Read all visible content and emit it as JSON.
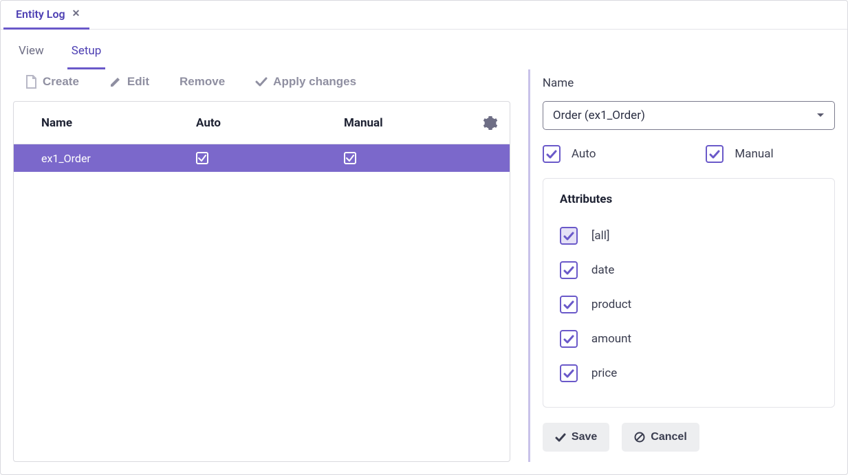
{
  "top_tab": {
    "title": "Entity Log"
  },
  "nav_tabs": {
    "view": "View",
    "setup": "Setup"
  },
  "toolbar": {
    "create": "Create",
    "edit": "Edit",
    "remove": "Remove",
    "apply": "Apply changes"
  },
  "table": {
    "headers": {
      "name": "Name",
      "auto": "Auto",
      "manual": "Manual"
    },
    "rows": [
      {
        "name": "ex1_Order",
        "auto": true,
        "manual": true
      }
    ]
  },
  "panel": {
    "name_label": "Name",
    "selected_entity": "Order (ex1_Order)",
    "auto_label": "Auto",
    "manual_label": "Manual",
    "attributes_title": "Attributes",
    "attributes": [
      {
        "label": "[all]",
        "checked": true,
        "highlight": true
      },
      {
        "label": "date",
        "checked": true
      },
      {
        "label": "product",
        "checked": true
      },
      {
        "label": "amount",
        "checked": true
      },
      {
        "label": "price",
        "checked": true
      }
    ],
    "save": "Save",
    "cancel": "Cancel"
  }
}
